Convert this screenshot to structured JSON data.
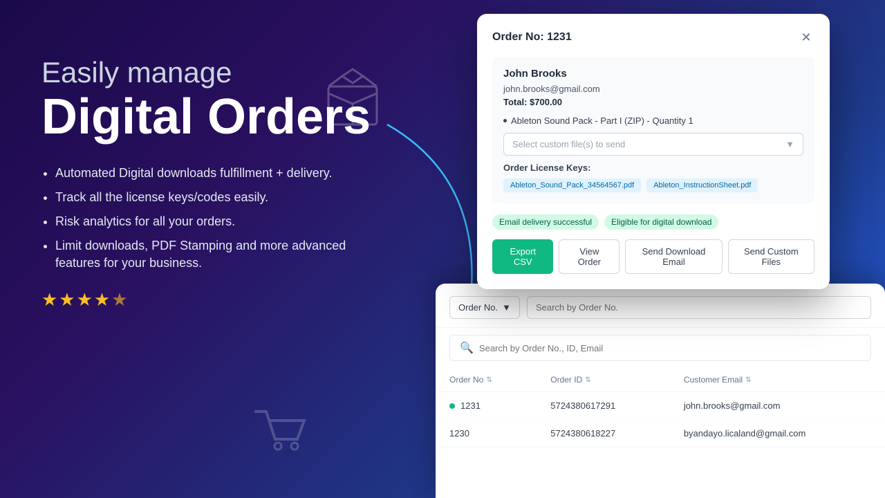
{
  "hero": {
    "easily_manage": "Easily manage",
    "digital_orders": "Digital Orders",
    "features": [
      "Automated Digital downloads fulfillment + delivery.",
      "Track all the license keys/codes easily.",
      "Risk analytics for all your orders.",
      "Limit downloads, PDF Stamping and more advanced features for your business."
    ],
    "stars": "★★★★☆"
  },
  "modal": {
    "title": "Order No: 1231",
    "customer": {
      "name": "John Brooks",
      "email": "john.brooks@gmail.com",
      "total": "Total: $700.00"
    },
    "product": "Ableton Sound Pack - Part I (ZIP) - Quantity 1",
    "file_select_placeholder": "Select custom file(s) to send",
    "license_keys_label": "Order License Keys:",
    "license_files": [
      "Ableton_Sound_Pack_34564567.pdf",
      "Ableton_InstructionSheet.pdf"
    ],
    "badges": [
      "Email delivery successful",
      "Eligible for digital download"
    ],
    "actions": {
      "export_csv": "Export CSV",
      "view_order": "View Order",
      "send_download_email": "Send Download Email",
      "send_custom_files": "Send Custom Files"
    }
  },
  "orders_panel": {
    "filter_label": "Order No.",
    "filter_placeholder": "Search by Order No.",
    "search_placeholder": "Search by Order No., ID, Email",
    "columns": [
      "Order No",
      "Order ID",
      "Customer Email"
    ],
    "rows": [
      {
        "order_no": "1231",
        "order_id": "5724380617291",
        "customer_email": "john.brooks@gmail.com",
        "highlighted": true
      },
      {
        "order_no": "1230",
        "order_id": "5724380618227",
        "customer_email": "byandayo.licaland@gmail.com",
        "highlighted": false
      }
    ]
  }
}
